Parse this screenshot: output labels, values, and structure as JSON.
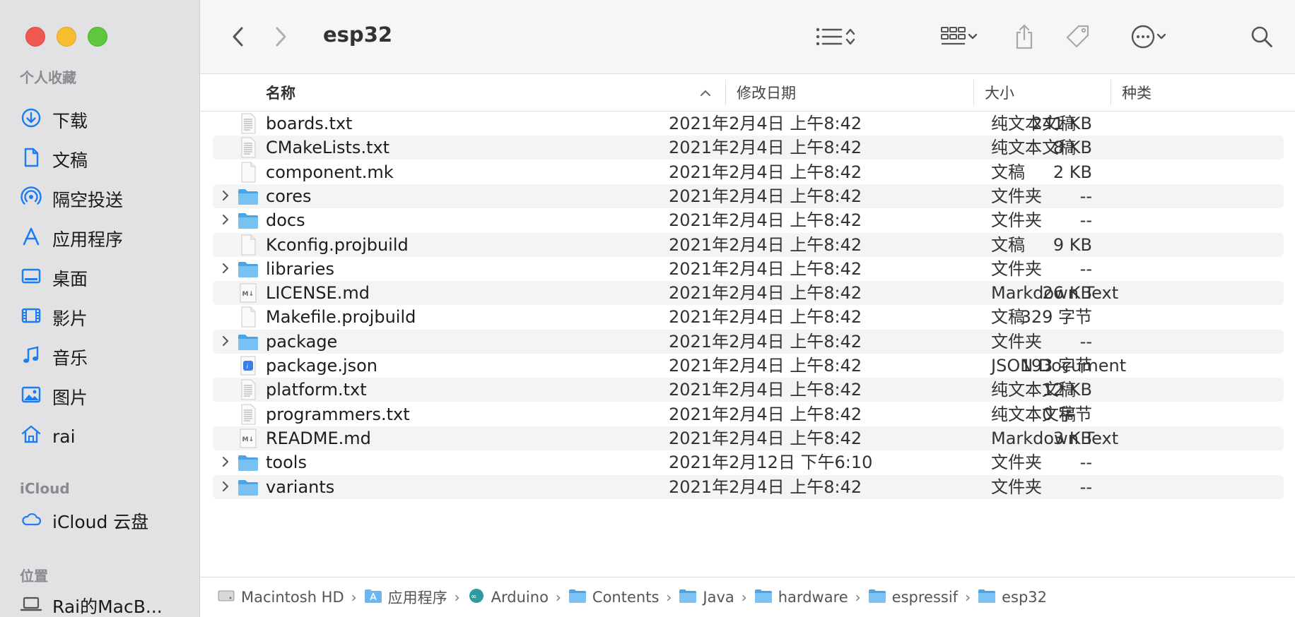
{
  "window": {
    "title": "esp32"
  },
  "sidebar": {
    "favorites_header": "个人收藏",
    "favorites": [
      {
        "label": "下载",
        "icon": "download-icon"
      },
      {
        "label": "文稿",
        "icon": "document-icon"
      },
      {
        "label": "隔空投送",
        "icon": "airdrop-icon"
      },
      {
        "label": "应用程序",
        "icon": "applications-icon"
      },
      {
        "label": "桌面",
        "icon": "desktop-icon"
      },
      {
        "label": "影片",
        "icon": "movies-icon"
      },
      {
        "label": "音乐",
        "icon": "music-icon"
      },
      {
        "label": "图片",
        "icon": "pictures-icon"
      },
      {
        "label": "rai",
        "icon": "home-icon"
      }
    ],
    "icloud_header": "iCloud",
    "icloud": [
      {
        "label": "iCloud 云盘",
        "icon": "cloud-icon"
      }
    ],
    "locations_header": "位置",
    "locations": [
      {
        "label": "Rai的MacB...",
        "icon": "laptop-icon"
      }
    ]
  },
  "columns": {
    "name": "名称",
    "date": "修改日期",
    "size": "大小",
    "kind": "种类"
  },
  "files": [
    {
      "name": "boards.txt",
      "date": "2021年2月4日 上午8:42",
      "size": "241 KB",
      "kind": "纯文本文稿",
      "type": "text",
      "expandable": false
    },
    {
      "name": "CMakeLists.txt",
      "date": "2021年2月4日 上午8:42",
      "size": "8 KB",
      "kind": "纯文本文稿",
      "type": "text",
      "expandable": false
    },
    {
      "name": "component.mk",
      "date": "2021年2月4日 上午8:42",
      "size": "2 KB",
      "kind": "文稿",
      "type": "blank",
      "expandable": false
    },
    {
      "name": "cores",
      "date": "2021年2月4日 上午8:42",
      "size": "--",
      "kind": "文件夹",
      "type": "folder",
      "expandable": true
    },
    {
      "name": "docs",
      "date": "2021年2月4日 上午8:42",
      "size": "--",
      "kind": "文件夹",
      "type": "folder",
      "expandable": true
    },
    {
      "name": "Kconfig.projbuild",
      "date": "2021年2月4日 上午8:42",
      "size": "9 KB",
      "kind": "文稿",
      "type": "blank",
      "expandable": false
    },
    {
      "name": "libraries",
      "date": "2021年2月4日 上午8:42",
      "size": "--",
      "kind": "文件夹",
      "type": "folder",
      "expandable": true
    },
    {
      "name": "LICENSE.md",
      "date": "2021年2月4日 上午8:42",
      "size": "26 KB",
      "kind": "Markdown Text",
      "type": "markdown",
      "expandable": false
    },
    {
      "name": "Makefile.projbuild",
      "date": "2021年2月4日 上午8:42",
      "size": "329 字节",
      "kind": "文稿",
      "type": "blank",
      "expandable": false
    },
    {
      "name": "package",
      "date": "2021年2月4日 上午8:42",
      "size": "--",
      "kind": "文件夹",
      "type": "folder",
      "expandable": true
    },
    {
      "name": "package.json",
      "date": "2021年2月4日 上午8:42",
      "size": "193 字节",
      "kind": "JSON Document",
      "type": "json",
      "expandable": false
    },
    {
      "name": "platform.txt",
      "date": "2021年2月4日 上午8:42",
      "size": "12 KB",
      "kind": "纯文本文稿",
      "type": "text",
      "expandable": false
    },
    {
      "name": "programmers.txt",
      "date": "2021年2月4日 上午8:42",
      "size": "0 字节",
      "kind": "纯文本文稿",
      "type": "text",
      "expandable": false
    },
    {
      "name": "README.md",
      "date": "2021年2月4日 上午8:42",
      "size": "3 KB",
      "kind": "Markdown Text",
      "type": "markdown",
      "expandable": false
    },
    {
      "name": "tools",
      "date": "2021年2月12日 下午6:10",
      "size": "--",
      "kind": "文件夹",
      "type": "folder",
      "expandable": true
    },
    {
      "name": "variants",
      "date": "2021年2月4日 上午8:42",
      "size": "--",
      "kind": "文件夹",
      "type": "folder",
      "expandable": true
    }
  ],
  "pathbar": [
    {
      "label": "Macintosh HD",
      "icon": "disk-icon"
    },
    {
      "label": "应用程序",
      "icon": "applications-folder-icon"
    },
    {
      "label": "Arduino",
      "icon": "arduino-icon"
    },
    {
      "label": "Contents",
      "icon": "folder-icon"
    },
    {
      "label": "Java",
      "icon": "folder-icon"
    },
    {
      "label": "hardware",
      "icon": "folder-icon"
    },
    {
      "label": "espressif",
      "icon": "folder-icon"
    },
    {
      "label": "esp32",
      "icon": "folder-icon"
    }
  ],
  "colors": {
    "accent": "#1c7cf4",
    "folder": "#5cb6f1",
    "sidebar_bg": "#e2e2e4"
  }
}
